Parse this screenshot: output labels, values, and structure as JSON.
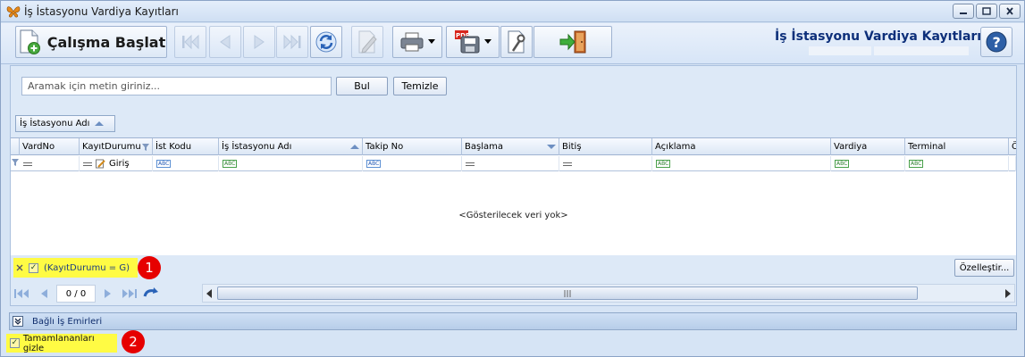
{
  "window": {
    "title": "İş İstasyonu Vardiya Kayıtları"
  },
  "toolbar": {
    "start_label": "Çalışma Başlat",
    "title": "İş İstasyonu Vardiya Kayıtları"
  },
  "search": {
    "placeholder": "Aramak için metin giriniz...",
    "find_label": "Bul",
    "clear_label": "Temizle"
  },
  "group_panel": {
    "chip_label": "İş İstasyonu Adı"
  },
  "grid": {
    "columns": [
      "VardNo",
      "KayıtDurumu",
      "İst Kodu",
      "İş İstasyonu Adı",
      "Takip No",
      "Başlama",
      "Bitiş",
      "Açıklama",
      "Vardiya",
      "Terminal",
      "Öz"
    ],
    "filter_status_value": "Giriş",
    "empty_text": "<Gösterilecek veri yok>"
  },
  "filter_bar": {
    "expression": "(KayıtDurumu = G)",
    "customize_label": "Özelleştir...",
    "badge_1": "1"
  },
  "navigator": {
    "page": "0 / 0"
  },
  "related": {
    "label": "Bağlı İş Emirleri"
  },
  "options": {
    "hide_completed_label": "Tamamlananları gizle",
    "badge_2": "2"
  },
  "colors": {
    "accent": "#0d2f7a",
    "highlight": "#fffb44",
    "badge": "#e60000"
  }
}
